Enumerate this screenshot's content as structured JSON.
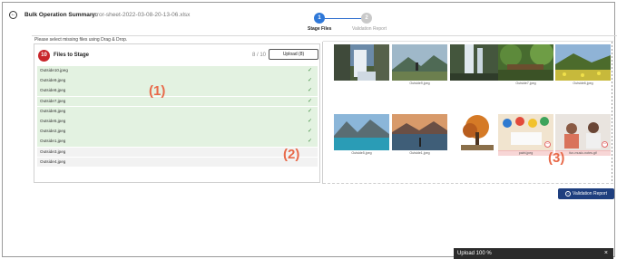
{
  "header": {
    "title": "Bulk Operation Summary:",
    "filename": "error-sheet-2022-03-08-20-13-06.xlsx"
  },
  "stepper": {
    "steps": [
      {
        "number": "1",
        "label": "Stage Files",
        "active": true
      },
      {
        "number": "2",
        "label": "Validation Report",
        "active": false
      }
    ]
  },
  "hint": "Please select missing files using Drag & Drop.",
  "files_panel": {
    "count": "10",
    "title": "Files to Stage",
    "progress": "8 / 10",
    "upload_label": "Upload (8)",
    "files": [
      {
        "name": "Outside10.jpeg",
        "status": "done",
        "check": "✓"
      },
      {
        "name": "Outside9.jpeg",
        "status": "done",
        "check": "✓"
      },
      {
        "name": "Outside8.jpeg",
        "status": "done",
        "check": "✓"
      },
      {
        "name": "Outside7.jpeg",
        "status": "done",
        "check": "✓"
      },
      {
        "name": "Outside6.jpeg",
        "status": "done",
        "check": "✓"
      },
      {
        "name": "Outside5.jpeg",
        "status": "done",
        "check": "✓"
      },
      {
        "name": "Outside2.jpeg",
        "status": "done",
        "check": "✓"
      },
      {
        "name": "Outside1.jpeg",
        "status": "done",
        "check": "✓"
      },
      {
        "name": "Outside3.jpeg",
        "status": "pending",
        "check": ""
      },
      {
        "name": "Outside4.jpeg",
        "status": "pending",
        "check": ""
      }
    ]
  },
  "annotations": {
    "one": "(1)",
    "two": "(2)",
    "three": "(3)"
  },
  "gallery": {
    "images": [
      {
        "caption": "",
        "scene": "waterfall-rocks",
        "error": false
      },
      {
        "caption": "Outside9.jpeg",
        "scene": "mountain-hiker",
        "error": false
      },
      {
        "caption": "",
        "scene": "tall-waterfall",
        "error": false
      },
      {
        "caption": "Outside7.jpeg",
        "scene": "forest-bridge",
        "error": false
      },
      {
        "caption": "Outside6.jpeg",
        "scene": "meadow-flowers",
        "error": false
      },
      {
        "caption": "Outside5.jpeg",
        "scene": "turquoise-lake",
        "error": false
      },
      {
        "caption": "Outside1.jpeg",
        "scene": "lake-reflection",
        "error": false
      },
      {
        "caption": "",
        "scene": "autumn-tree",
        "error": false
      },
      {
        "caption": "paint.jpeg",
        "scene": "paint-palette",
        "error": true
      },
      {
        "caption": "fun-music-notes.gif",
        "scene": "people-music",
        "error": true
      }
    ]
  },
  "validation_button": {
    "label": "Validation Report",
    "icon": "arrow-right-circle-icon"
  },
  "toast": {
    "text": "Upload 100 %",
    "close": "×"
  },
  "colors": {
    "accent": "#2f78d8",
    "badge": "#c8262b",
    "done_row": "#e3f2e1",
    "error_caption": "#f7d6d6",
    "annotation": "#e86a4a",
    "primary_button": "#1f3f7f"
  }
}
